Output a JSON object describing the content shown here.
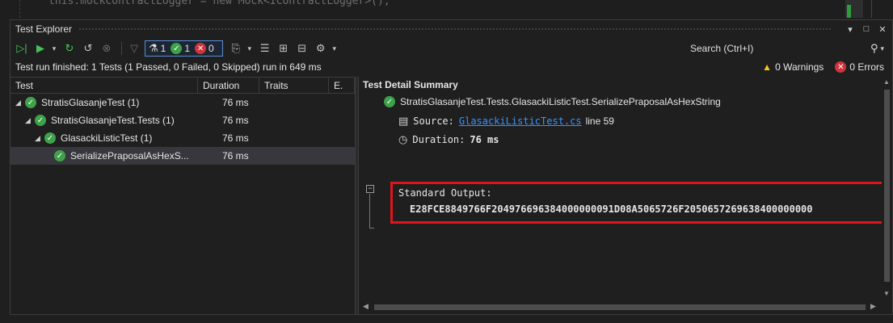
{
  "editor": {
    "code_fragment": "this.mockContractLogger = new Mock<IContractLogger>();"
  },
  "window": {
    "title": "Test Explorer",
    "controls": [
      "▾",
      "□",
      "✕"
    ]
  },
  "toolbar": {
    "filters": {
      "total": "1",
      "passed": "1",
      "failed": "0"
    },
    "search_placeholder": "Search (Ctrl+I)"
  },
  "status": {
    "message": "Test run finished: 1 Tests (1 Passed, 0 Failed, 0 Skipped) run in 649 ms",
    "warnings": "0 Warnings",
    "errors": "0 Errors"
  },
  "tree": {
    "columns": {
      "test": "Test",
      "duration": "Duration",
      "traits": "Traits",
      "error": "E."
    },
    "rows": [
      {
        "label": "StratisGlasanjeTest (1)",
        "duration": "76 ms",
        "level": 0
      },
      {
        "label": "StratisGlasanjeTest.Tests (1)",
        "duration": "76 ms",
        "level": 1
      },
      {
        "label": "GlasackiListicTest (1)",
        "duration": "76 ms",
        "level": 2
      },
      {
        "label": "SerializePraposalAsHexS...",
        "duration": "76 ms",
        "level": 3
      }
    ]
  },
  "detail": {
    "heading": "Test Detail Summary",
    "test_full_name": "StratisGlasanjeTest.Tests.GlasackiListicTest.SerializePraposalAsHexString",
    "source_label": "Source:",
    "source_file": "GlasackiListicTest.cs",
    "source_line": "line 59",
    "duration_label": "Duration:",
    "duration_value": "76 ms",
    "stdout_label": "Standard Output:",
    "stdout_value": "E28FCE8849766F204976696384000000091D08A5065726F2050657269638400000000"
  },
  "colors": {
    "pass": "#3ea24a",
    "fail": "#d0343b",
    "link": "#3794ff",
    "highlight": "#e0141c",
    "warning": "#f5c518"
  }
}
